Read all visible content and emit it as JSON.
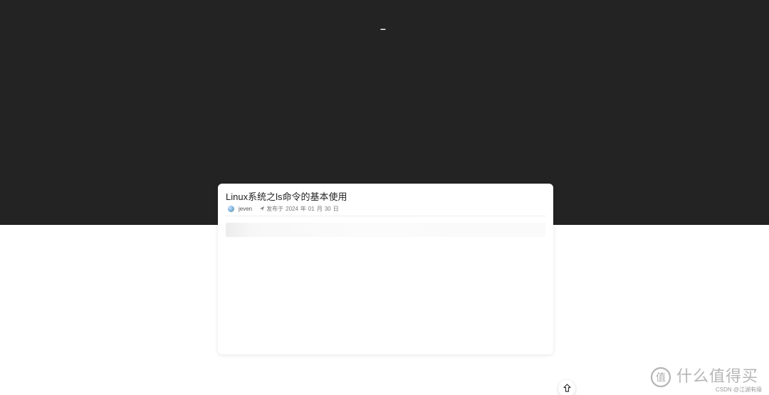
{
  "hero": {
    "mark": "–"
  },
  "post": {
    "title": "Linux系统之ls命令的基本使用",
    "author": "jeven",
    "publish_label": "发布于",
    "year": "2024",
    "year_unit": "年",
    "month": "01",
    "month_unit": "月",
    "day": "30",
    "day_unit": "日"
  },
  "icons": {
    "avatar": "avatar-icon",
    "publish": "paper-plane-icon",
    "back_to_top": "arrow-up-icon"
  },
  "watermark": {
    "brand": "什么值得买",
    "credit": "CSDN @江湖有缘"
  },
  "colors": {
    "hero_background": "#232323",
    "page_background": "#ffffff",
    "title_text": "#222222",
    "meta_text": "#777777"
  }
}
